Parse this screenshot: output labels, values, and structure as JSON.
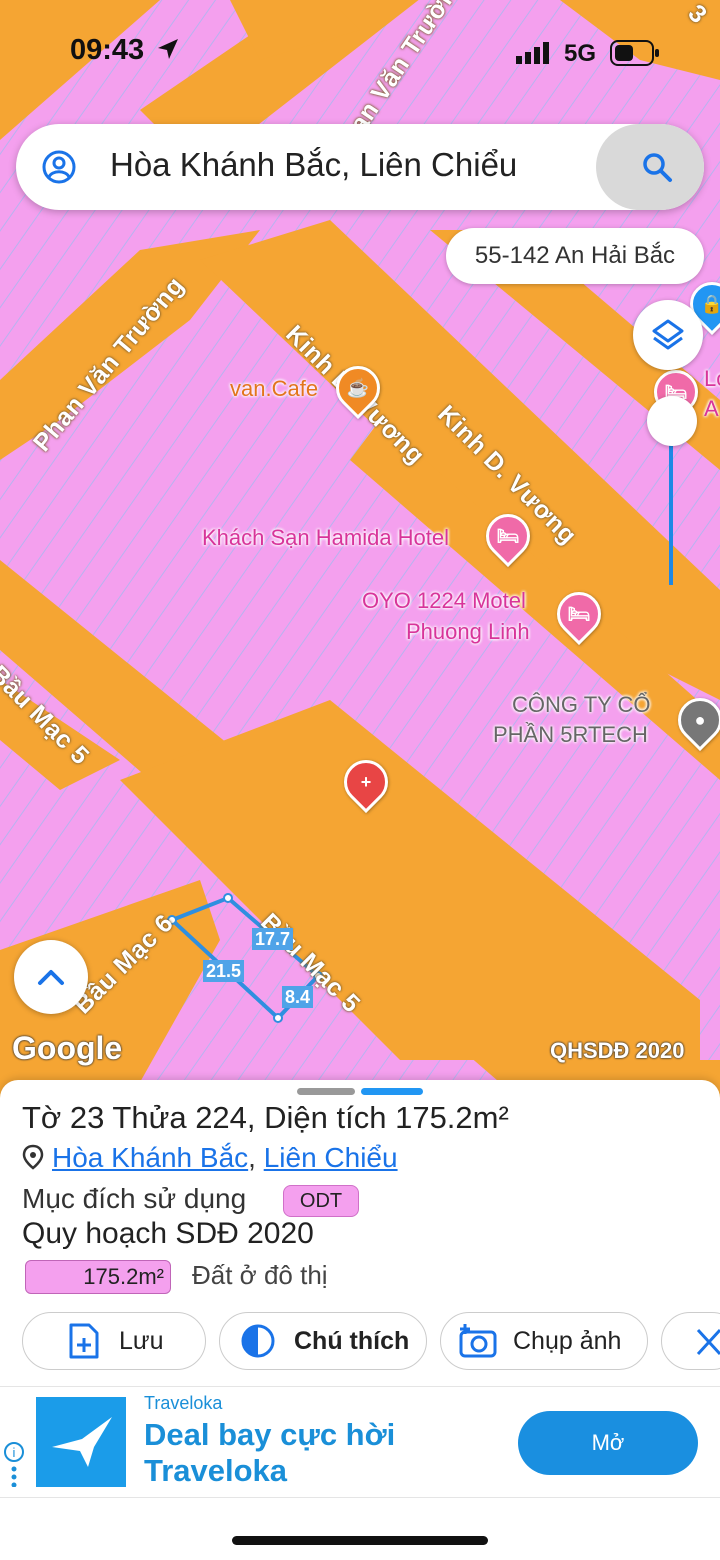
{
  "status_bar": {
    "time": "09:43",
    "network": "5G"
  },
  "search": {
    "text": "Hòa Khánh Bắc, Liên Chiểu"
  },
  "address_chip": "55-142 An Hải Bắc",
  "map": {
    "road_labels": [
      "Phan Văn Trường",
      "Phan Văn Trường",
      "Kinh D. Vương",
      "Kinh D. Vương",
      "Bầu Mạc 5",
      "Bầu Mạc 5",
      "Bầu Mạc 6",
      "3"
    ],
    "pois": [
      "van.Cafe",
      "Khách Sạn Hamida Hotel",
      "OYO 1224 Motel",
      "Phuong Linh",
      "CÔNG TY CỔ",
      "PHẦN 5RTECH",
      "Lo",
      "A"
    ],
    "dimensions": [
      "17.7",
      "21.5",
      "8.4"
    ],
    "attribution": "Google",
    "layer_name": "QHSDĐ 2020"
  },
  "sheet": {
    "title": "Tờ 23 Thửa 224, Diện tích 175.2m²",
    "ward": "Hòa Khánh Bắc",
    "separator": ", ",
    "district": "Liên Chiểu",
    "purpose_label": "Mục đích sử dụng",
    "purpose_code": "ODT",
    "plan_label": "Quy hoạch SDĐ 2020",
    "area_value": "175.2m²",
    "area_desc": "Đất ở đô thị",
    "actions": [
      "Lưu",
      "Chú thích",
      "Chụp ảnh"
    ]
  },
  "ad": {
    "brand": "Traveloka",
    "headline_1": "Deal bay cực hời",
    "headline_2": "Traveloka",
    "cta": "Mở"
  },
  "colors": {
    "zone_pink": "#f4a0ee",
    "road_orange": "#f5a533",
    "accent_blue": "#1a73e8"
  }
}
